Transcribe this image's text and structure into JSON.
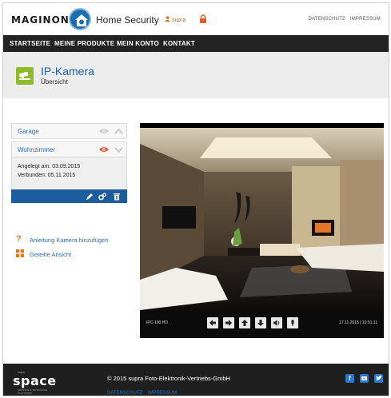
{
  "header": {
    "brand": "MAGINON",
    "product": "Home Security",
    "user": "supra",
    "links": [
      "DATENSCHUTZ",
      "IMPRESSUM"
    ]
  },
  "nav": {
    "items": [
      "STARTSEITE",
      "MEINE PRODUKTE",
      "MEIN KONTO",
      "KONTAKT"
    ]
  },
  "page": {
    "title": "IP-Kamera",
    "subtitle": "Übersicht"
  },
  "cameras": [
    {
      "name": "Garage",
      "eye_color": "#c8c8c8"
    },
    {
      "name": "Wohnzimmer",
      "eye_color": "#e2542a"
    }
  ],
  "selected_camera": {
    "created": "Angelegt am: 03.09.2015",
    "connected": "Verbunden: 05.11.2015"
  },
  "actions": [
    "pencil-icon",
    "gears-icon",
    "trash-icon"
  ],
  "links": {
    "add_camera": "Anleitung Kamera hinzufügen",
    "shared_view": "Geteilte Ansicht"
  },
  "video": {
    "camera_label": "IPC-100 HD",
    "timestamp": "17.11.2015 | 10:51:11",
    "controls": [
      "arrow-left-icon",
      "arrow-right-icon",
      "arrow-up-icon",
      "arrow-down-icon",
      "speaker-icon",
      "mic-icon"
    ]
  },
  "footer": {
    "logo": "space",
    "logo_top": "supra",
    "logo_tagline": "SERVICE & RESOURCE PLATFORM",
    "copyright": "© 2015 supra Foto-Elektronik-Vertriebs-GmbH",
    "links": [
      "DATENSCHUTZ",
      "IMPRESSUM"
    ],
    "social": [
      "facebook-icon",
      "youtube-icon",
      "twitter-icon"
    ]
  },
  "colors": {
    "accent_blue": "#1c5d9e",
    "link_blue": "#2a6cb6",
    "camera_green": "#8dbb2c",
    "orange": "#e07a1c",
    "nav_dark": "#232323"
  }
}
